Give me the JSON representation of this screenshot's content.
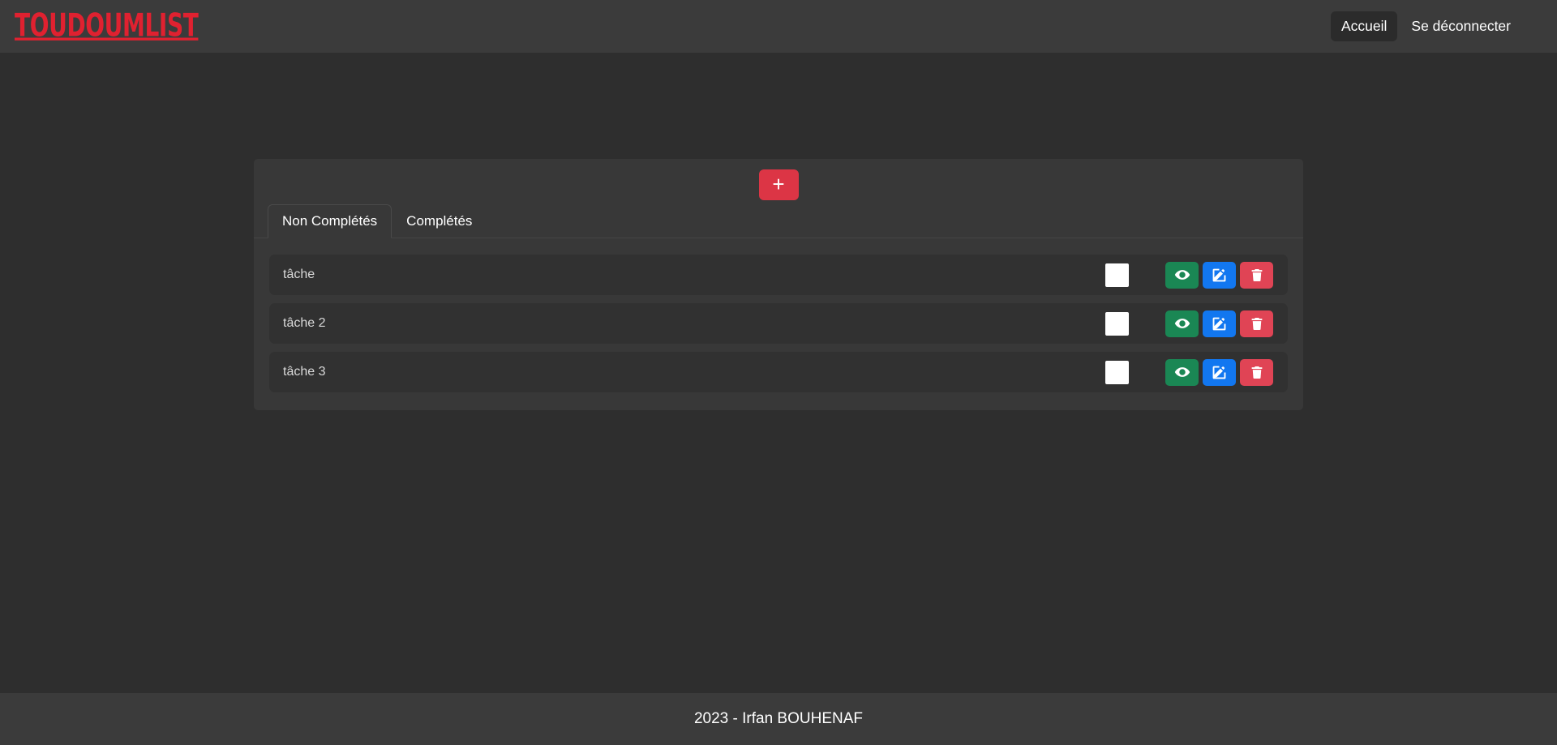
{
  "navbar": {
    "brand": "TOUDOUMLIST",
    "links": [
      {
        "label": "Accueil",
        "active": true
      },
      {
        "label": "Se déconnecter",
        "active": false
      }
    ]
  },
  "card": {
    "add_button": {
      "label": "+",
      "icon": "plus-icon",
      "color": "#dc3545"
    },
    "tabs": [
      {
        "label": "Non Complétés",
        "active": true
      },
      {
        "label": "Complétés",
        "active": false
      }
    ],
    "tasks": [
      {
        "title": "tâche",
        "checked": false,
        "actions": [
          {
            "name": "view",
            "icon": "eye-icon",
            "color": "#1a8754"
          },
          {
            "name": "edit",
            "icon": "pen-square-icon",
            "color": "#1277f0"
          },
          {
            "name": "delete",
            "icon": "trash-icon",
            "color": "#e04455"
          }
        ]
      },
      {
        "title": "tâche 2",
        "checked": false,
        "actions": [
          {
            "name": "view",
            "icon": "eye-icon",
            "color": "#1a8754"
          },
          {
            "name": "edit",
            "icon": "pen-square-icon",
            "color": "#1277f0"
          },
          {
            "name": "delete",
            "icon": "trash-icon",
            "color": "#e04455"
          }
        ]
      },
      {
        "title": "tâche 3",
        "checked": false,
        "actions": [
          {
            "name": "view",
            "icon": "eye-icon",
            "color": "#1a8754"
          },
          {
            "name": "edit",
            "icon": "pen-square-icon",
            "color": "#1277f0"
          },
          {
            "name": "delete",
            "icon": "trash-icon",
            "color": "#e04455"
          }
        ]
      }
    ]
  },
  "footer": {
    "text": "2023 - Irfan BOUHENAF"
  },
  "theme": {
    "page_bg": "#2e2e2e",
    "bar_bg": "#3b3b3b",
    "card_bg": "#383838",
    "row_bg": "#313131",
    "brand_color": "#e02130"
  }
}
